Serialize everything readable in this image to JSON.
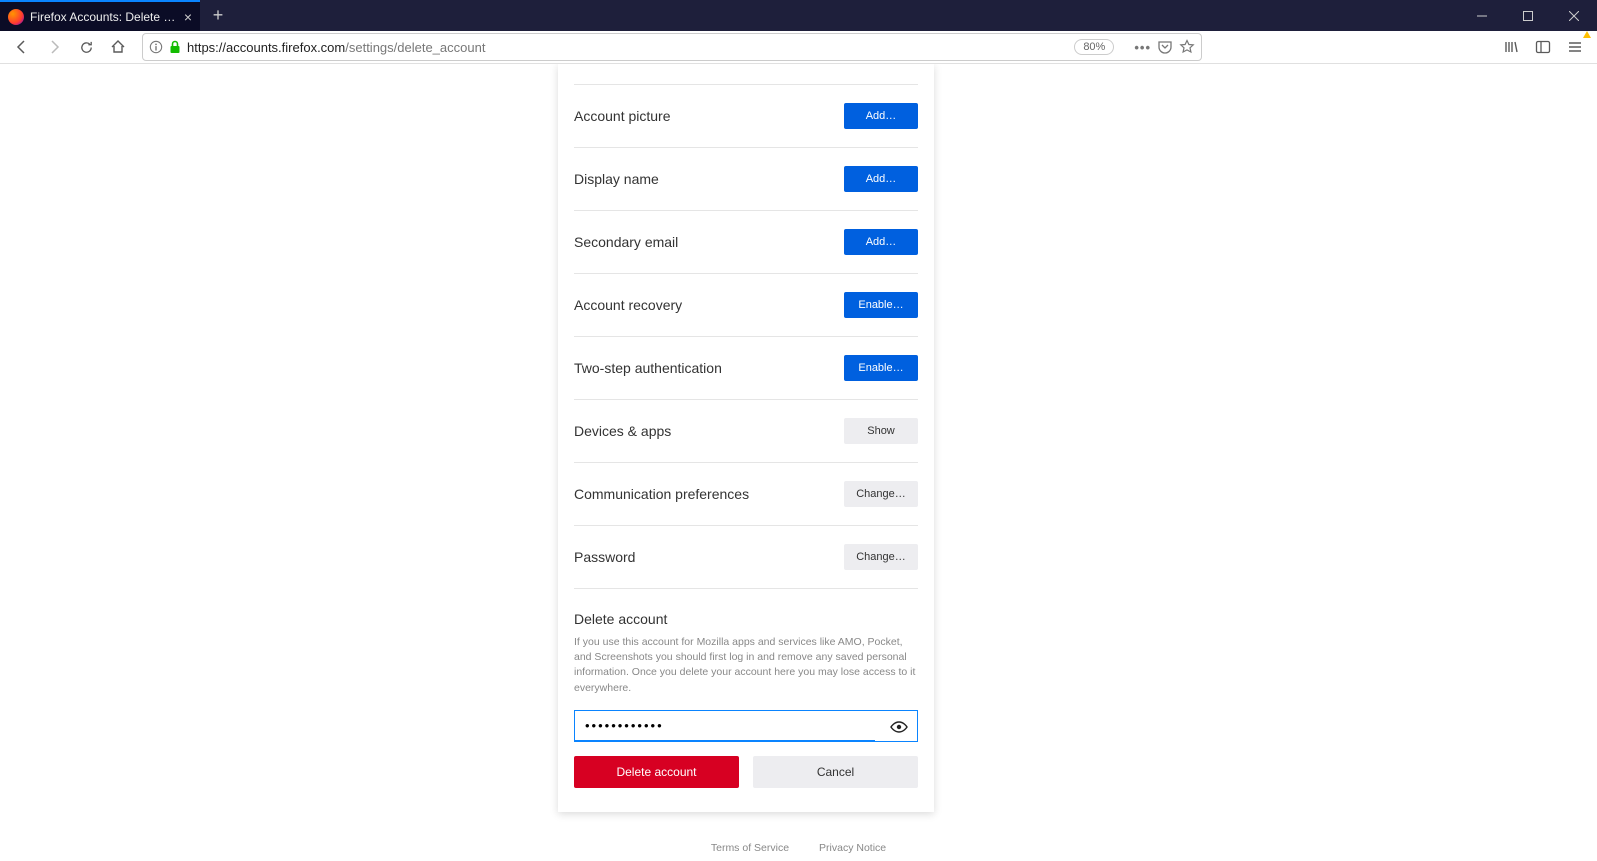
{
  "browser": {
    "tab_title": "Firefox Accounts: Delete accou",
    "url_host": "https://accounts.firefox.com",
    "url_path": "/settings/delete_account",
    "zoom": "80%"
  },
  "settings_rows": [
    {
      "label": "Account picture",
      "action": "Add…",
      "style": "blue"
    },
    {
      "label": "Display name",
      "action": "Add…",
      "style": "blue"
    },
    {
      "label": "Secondary email",
      "action": "Add…",
      "style": "blue"
    },
    {
      "label": "Account recovery",
      "action": "Enable…",
      "style": "blue"
    },
    {
      "label": "Two-step authentication",
      "action": "Enable…",
      "style": "blue"
    },
    {
      "label": "Devices & apps",
      "action": "Show",
      "style": "gray"
    },
    {
      "label": "Communication preferences",
      "action": "Change…",
      "style": "gray"
    },
    {
      "label": "Password",
      "action": "Change…",
      "style": "gray"
    }
  ],
  "delete_section": {
    "title": "Delete account",
    "help": "If you use this account for Mozilla apps and services like AMO, Pocket, and Screenshots you should first log in and remove any saved personal information. Once you delete your account here you may lose access to it everywhere.",
    "password_value": "••••••••••••",
    "delete_label": "Delete account",
    "cancel_label": "Cancel"
  },
  "footer": {
    "terms": "Terms of Service",
    "privacy": "Privacy Notice"
  }
}
